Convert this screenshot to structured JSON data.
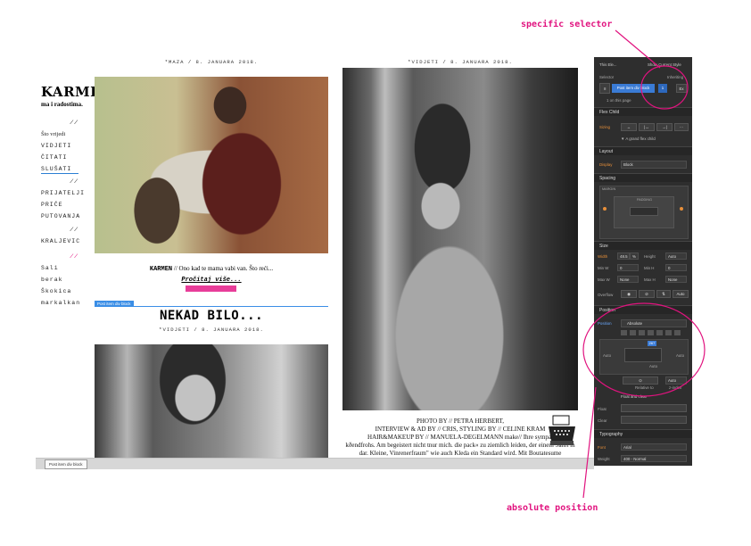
{
  "site": {
    "brand": "KARMEN",
    "brand_sub": "ma i radostima.",
    "nav_group1": {
      "slash": "//",
      "intro": "Što vrijedi",
      "items": [
        "VIDJETI",
        "ČITATI",
        "SLUŠATI"
      ]
    },
    "nav_group2": {
      "slash": "//",
      "items": [
        "PRIJATELJI",
        "PRIČE",
        "PUTOVANJA"
      ]
    },
    "nav_group3": {
      "slash": "//",
      "items": [
        "KRALJEVIC"
      ]
    },
    "nav_group4": {
      "slash": "//",
      "items": [
        "Sali berak",
        "Škokica",
        "markalkan"
      ]
    }
  },
  "posts": {
    "date1": "*MAZA / 8. JANUARA 2018.",
    "date2": "*VIDJETI / 8. JANUARA 2018.",
    "caption1_name": "KARMEN",
    "caption1_text": " // Ono kad te mama vabi van. Što reći...",
    "readmore": "Pročitaj više...",
    "tag": "Post item div block",
    "title2": "NEKAD BILO...",
    "date3": "*VIDJETI / 8. JANUARA 2018.",
    "credits": [
      "PHOTO BY // PETRA HERBERT,",
      "INTERVIEW & AD BY // CRIS, STYLING BY // CELINE KRAM",
      "HAIR&MAKEUP BY // MANUELA-DEGELMANN make// Ihre sympat",
      "kðendfrohs. Am begeistert nicht tnur mich. die pack« zu ziemlich leiden, der einem Sanft in",
      "dar. Kleine, Vinrenerfraum\" wie auch Kleda ein Standard wird. Mit Boutatesume"
    ]
  },
  "bottom_tab": "Post item div block",
  "panel": {
    "top_left": "This Ele...",
    "top_right": "Show Current Style",
    "selector_label": "Selector",
    "inheriting": "Inheriting",
    "selector_chip": "Post item div block",
    "selector_count": "1",
    "selector_extra": "Ex",
    "on_page": "1 on this page",
    "flex_child": "Flex Child",
    "sizing": "Sizing",
    "flex_note": "▼ A grand flex child",
    "layout": "Layout",
    "display_label": "Display",
    "display_value": "Block",
    "spacing": "Spacing",
    "margin": "MARGIN",
    "padding": "PADDING",
    "size": "Size",
    "width_label": "Width",
    "width_value": "48.5",
    "width_unit": "%",
    "height_label": "Height",
    "height_value": "Auto",
    "minw_label": "Min W",
    "minw_value": "0",
    "minh_label": "Min H",
    "minh_value": "0",
    "maxw_label": "Max W",
    "maxw_value": "None",
    "maxh_label": "Max H",
    "maxh_value": "None",
    "overflow_label": "Overflow",
    "overflow_auto": "Auto",
    "position": "Position",
    "position_label": "Position",
    "position_value": "Absolute",
    "pos_top": "267",
    "pos_auto_left": "Auto",
    "pos_auto_right": "Auto",
    "pos_auto_bottom": "Auto",
    "relative_to": "Relative to",
    "z_index_label": "z-index",
    "z_index_value": "Auto",
    "float_clear": "Float and clear",
    "float_label": "Float",
    "clear_label": "Clear",
    "typography": "Typography",
    "font_label": "Font",
    "font_value": "Arial",
    "weight_label": "Weight",
    "weight_value": "400 - Normal"
  },
  "annotations": {
    "specific_selector": "specific selector",
    "absolute_position": "absolute position"
  },
  "colors": {
    "accent": "#e1137f",
    "panel_bg": "#2e2e2e",
    "selection_blue": "#3b8ee6"
  }
}
